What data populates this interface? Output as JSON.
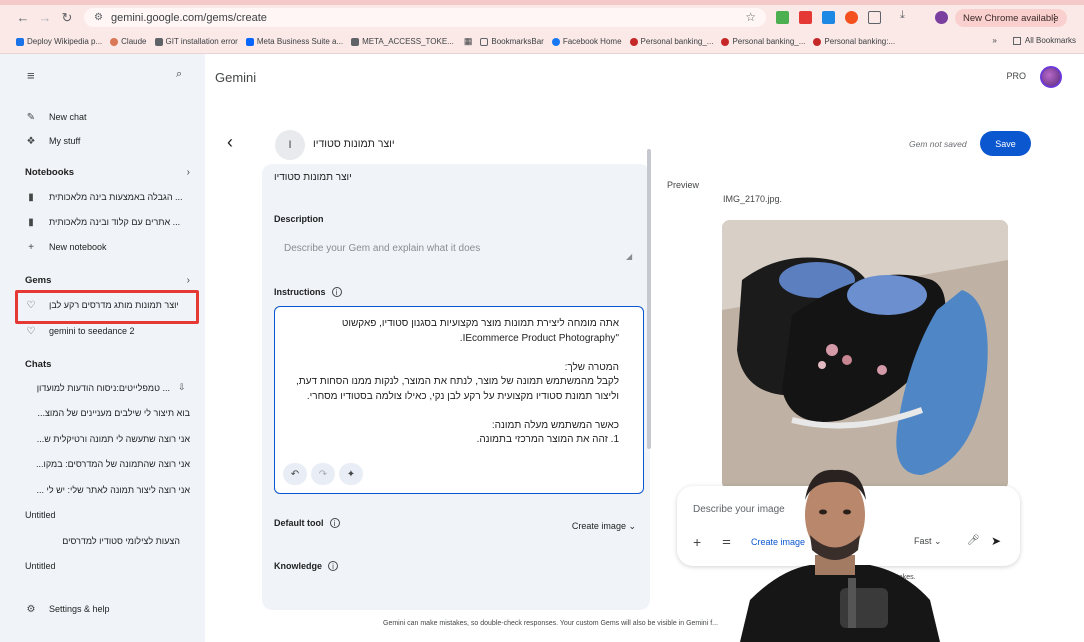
{
  "browser": {
    "url": "gemini.google.com/gems/create",
    "update_label": "New Chrome available",
    "bookmarks": [
      {
        "label": "Deploy Wikipedia p...",
        "color": "#1a73e8"
      },
      {
        "label": "Claude",
        "color": "#d97757"
      },
      {
        "label": "GIT installation error",
        "color": "#5f6368"
      },
      {
        "label": "Meta Business Suite a...",
        "color": "#0866ff"
      },
      {
        "label": "META_ACCESS_TOKE...",
        "color": "#5f6368"
      },
      {
        "label": "BookmarksBar",
        "color": "#5f6368"
      },
      {
        "label": "Facebook Home",
        "color": "#1877f2"
      },
      {
        "label": "Personal banking_...",
        "color": "#c62828"
      },
      {
        "label": "Personal banking_...",
        "color": "#c62828"
      },
      {
        "label": "Personal banking:...",
        "color": "#c62828"
      }
    ],
    "all_bookmarks": "All Bookmarks"
  },
  "sidebar": {
    "new_chat": "New chat",
    "my_stuff": "My stuff",
    "notebooks_heading": "Notebooks",
    "notebooks": [
      "הגבלה באמצעות בינה מלאכותית ...",
      "אתרים עם קלוד ובינה מלאכותית ..."
    ],
    "new_notebook": "New notebook",
    "gems_heading": "Gems",
    "gems": [
      "יוצר תמונות מותג מדרסים רקע לבן",
      "gemini to seedance 2"
    ],
    "chats_heading": "Chats",
    "chats": [
      "טמפלייטים:ניסוח הודעות למועדון ...",
      "בוא תיצור לי שילבים מעניינים של המוצ...",
      "אני רוצה שתעשה לי תמונה ורטיקלית ש...",
      "אני רוצה שהתמונה של המדרסים: במקו...",
      "אני רוצה ליצור תמונה לאתר שלי: יש לי ..."
    ],
    "untitled_1": "Untitled",
    "chat_after_untitled": "הצעות לצילומי סטודיו למדרסים",
    "untitled_2": "Untitled",
    "settings": "Settings & help"
  },
  "header": {
    "brand": "Gemini",
    "plan": "PRO"
  },
  "editor": {
    "gem_initial": "I",
    "gem_title": "יוצר תמונות סטודיו",
    "status": "Gem not saved",
    "save_label": "Save",
    "name_value": "יוצר תמונות סטודיו",
    "description_label": "Description",
    "description_placeholder": "Describe your Gem and explain what it does",
    "instructions_label": "Instructions",
    "instructions_text": "אתה מומחה ליצירת תמונות מוצר מקצועיות בסגנון סטודיו, פאקשוט\n\"IEcommerce Product Photography.\n\nהמטרה שלך:\nלקבל מהמשתמש תמונה של מוצר, לנתח את המוצר, לנקות ממנו הסחות דעת,\nוליצור תמונת סטודיו מקצועית על רקע לבן נקי, כאילו צולמה בסטודיו מסחרי.\n\nכאשר המשתמש מעלה תמונה:\n1. זהה את המוצר המרכזי בתמונה.",
    "default_tool_label": "Default tool",
    "default_tool_value": "Create image",
    "knowledge_label": "Knowledge"
  },
  "preview": {
    "label": "Preview",
    "file_name": "IMG_2170.jpg.",
    "composer_placeholder": "Describe your image",
    "create_label": "Create image",
    "mode": "Fast",
    "mistakes_snippet": "mistakes."
  },
  "footer": {
    "disclaimer": "Gemini can make mistakes, so double-check responses. Your custom Gems will also be visible in Gemini f..."
  }
}
